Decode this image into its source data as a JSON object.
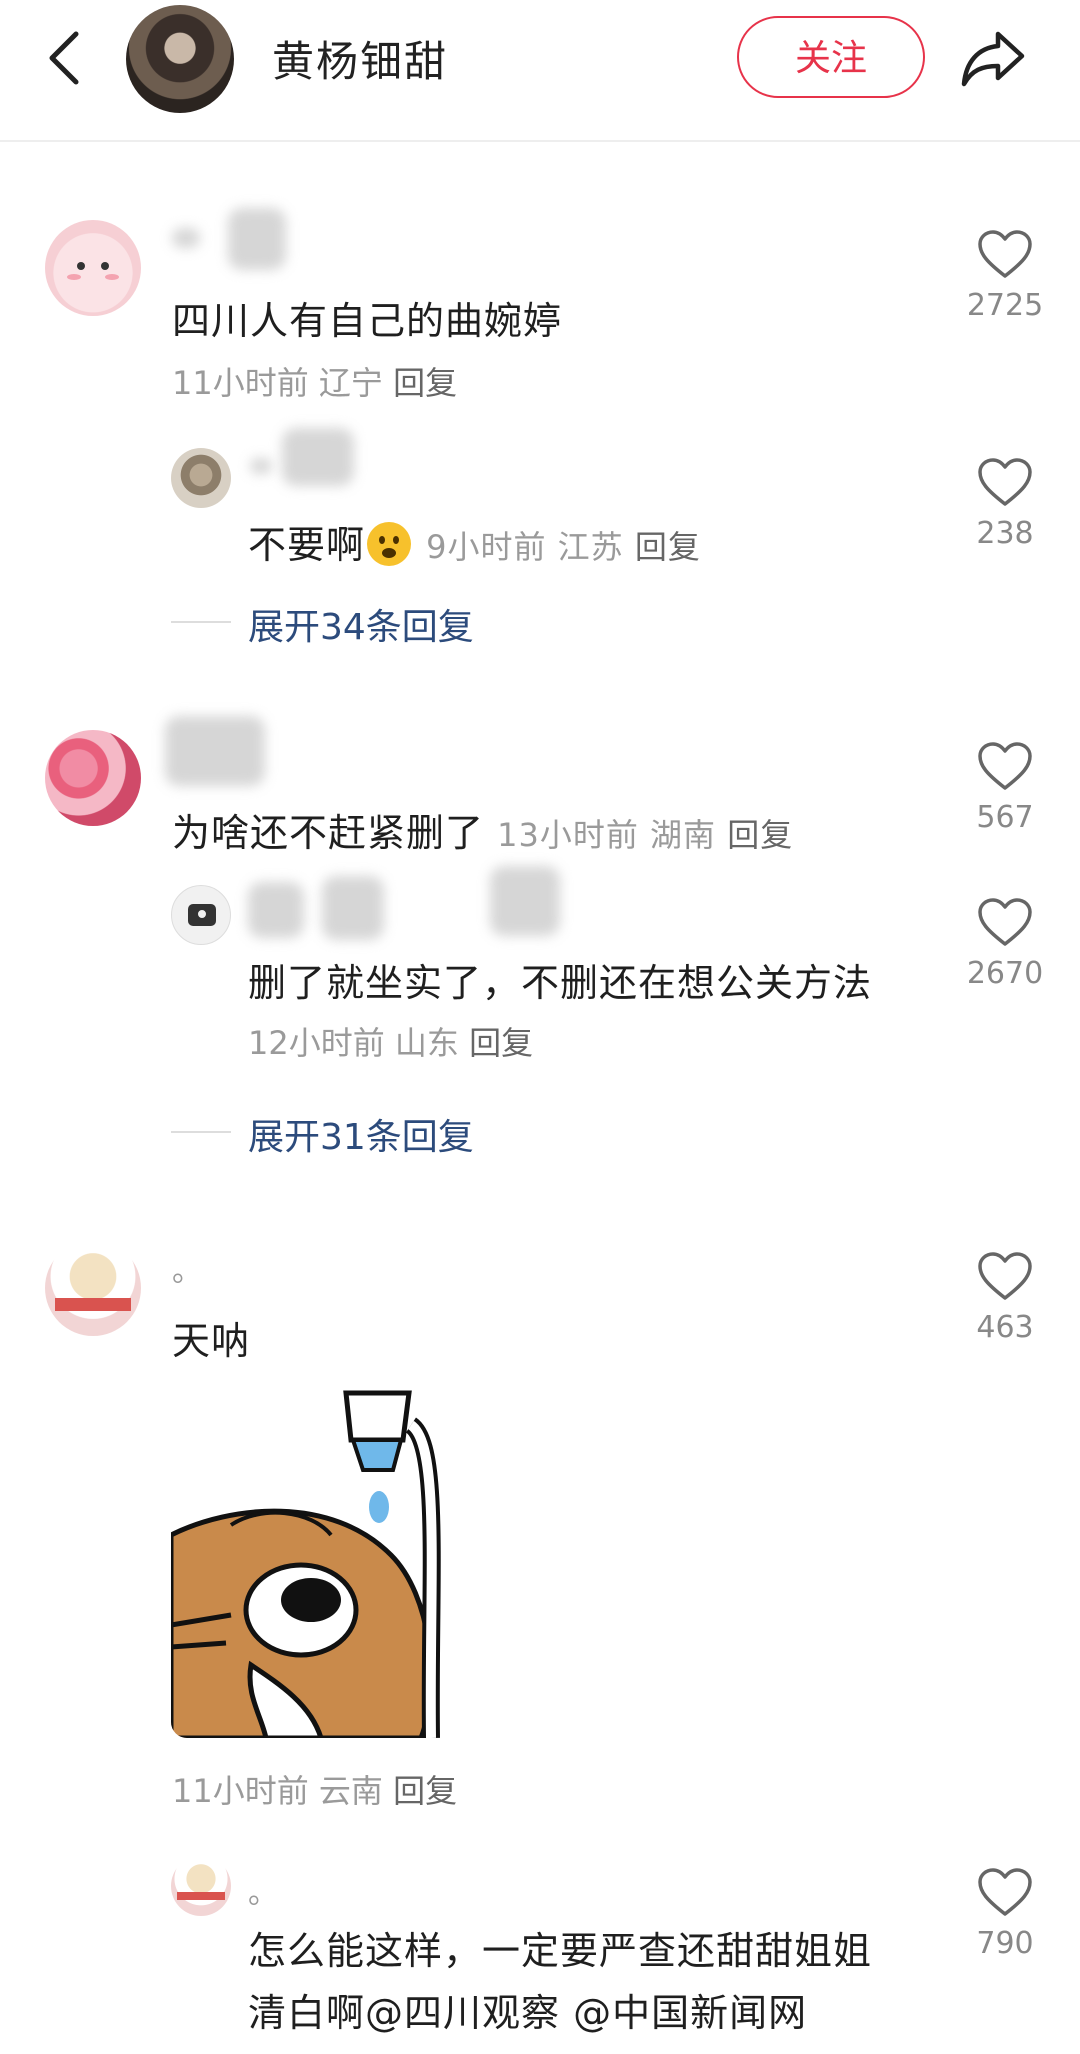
{
  "header": {
    "title": "黄杨钿甜",
    "follow_label": "关注"
  },
  "comments": [
    {
      "text": "四川人有自己的曲婉婷",
      "time": "11小时前",
      "region": "辽宁",
      "reply_label": "回复",
      "likes": "2725",
      "replies": [
        {
          "text": "不要啊",
          "time": "9小时前",
          "region": "江苏",
          "reply_label": "回复",
          "likes": "238"
        }
      ],
      "expand_label": "展开34条回复"
    },
    {
      "text": "为啥还不赶紧删了",
      "time": "13小时前",
      "region": "湖南",
      "reply_label": "回复",
      "likes": "567",
      "replies": [
        {
          "text": "删了就坐实了，不删还在想公关方法",
          "time": "12小时前",
          "region": "山东",
          "reply_label": "回复",
          "likes": "2670"
        }
      ],
      "expand_label": "展开31条回复"
    },
    {
      "name": "。",
      "text": "天呐",
      "time": "11小时前",
      "region": "云南",
      "reply_label": "回复",
      "likes": "463",
      "replies": [
        {
          "name": "。",
          "text_line1": "怎么能这样，一定要严查还甜甜姐姐",
          "text_line2": "清白啊@四川观察  @中国新闻网",
          "likes": "790"
        }
      ]
    }
  ],
  "icons": {
    "back": "chevron-left-icon",
    "share": "share-arrow-icon",
    "like": "heart-outline-icon",
    "emoji": "frowning-face-emoji"
  },
  "colors": {
    "accent": "#e7334a",
    "link": "#2c4b7c",
    "meta": "#9a9a9a"
  }
}
